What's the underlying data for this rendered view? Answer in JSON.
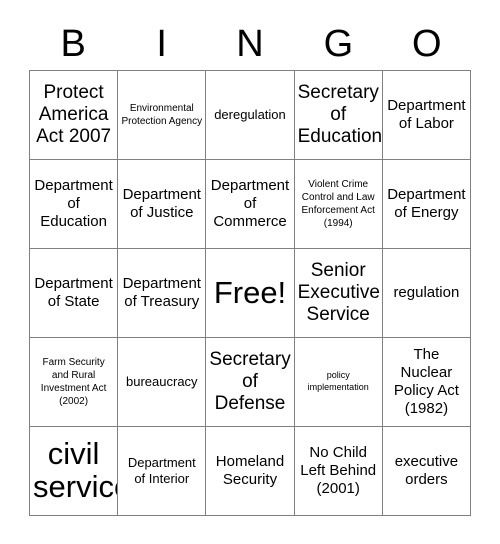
{
  "card": {
    "headers": [
      "B",
      "I",
      "N",
      "G",
      "O"
    ],
    "free_space_label": "Free!",
    "cells": [
      [
        {
          "text": "Protect America Act 2007",
          "size": "lg"
        },
        {
          "text": "Environmental Protection Agency",
          "size": "xs"
        },
        {
          "text": "deregulation",
          "size": "sm"
        },
        {
          "text": "Secretary of Education",
          "size": "lg"
        },
        {
          "text": "Department of Labor",
          "size": "md"
        }
      ],
      [
        {
          "text": "Department of Education",
          "size": "md"
        },
        {
          "text": "Department of Justice",
          "size": "md"
        },
        {
          "text": "Department of Commerce",
          "size": "md"
        },
        {
          "text": "Violent Crime Control and Law Enforcement Act (1994)",
          "size": "xs"
        },
        {
          "text": "Department of Energy",
          "size": "md"
        }
      ],
      [
        {
          "text": "Department of State",
          "size": "md"
        },
        {
          "text": "Department of Treasury",
          "size": "md"
        },
        {
          "text": "Free!",
          "size": "xl"
        },
        {
          "text": "Senior Executive Service",
          "size": "lg"
        },
        {
          "text": "regulation",
          "size": "md"
        }
      ],
      [
        {
          "text": "Farm Security and Rural Investment Act (2002)",
          "size": "xs"
        },
        {
          "text": "bureaucracy",
          "size": "sm"
        },
        {
          "text": "Secretary of Defense",
          "size": "lg"
        },
        {
          "text": "policy implementation",
          "size": "xxs"
        },
        {
          "text": "The Nuclear Policy Act (1982)",
          "size": "md"
        }
      ],
      [
        {
          "text": "civil service",
          "size": "xl"
        },
        {
          "text": "Department of Interior",
          "size": "sm"
        },
        {
          "text": "Homeland Security",
          "size": "md"
        },
        {
          "text": "No Child Left Behind (2001)",
          "size": "md"
        },
        {
          "text": "executive orders",
          "size": "md"
        }
      ]
    ]
  },
  "colors": {
    "background": "#ffffff",
    "text": "#000000",
    "grid_line": "#808080"
  }
}
